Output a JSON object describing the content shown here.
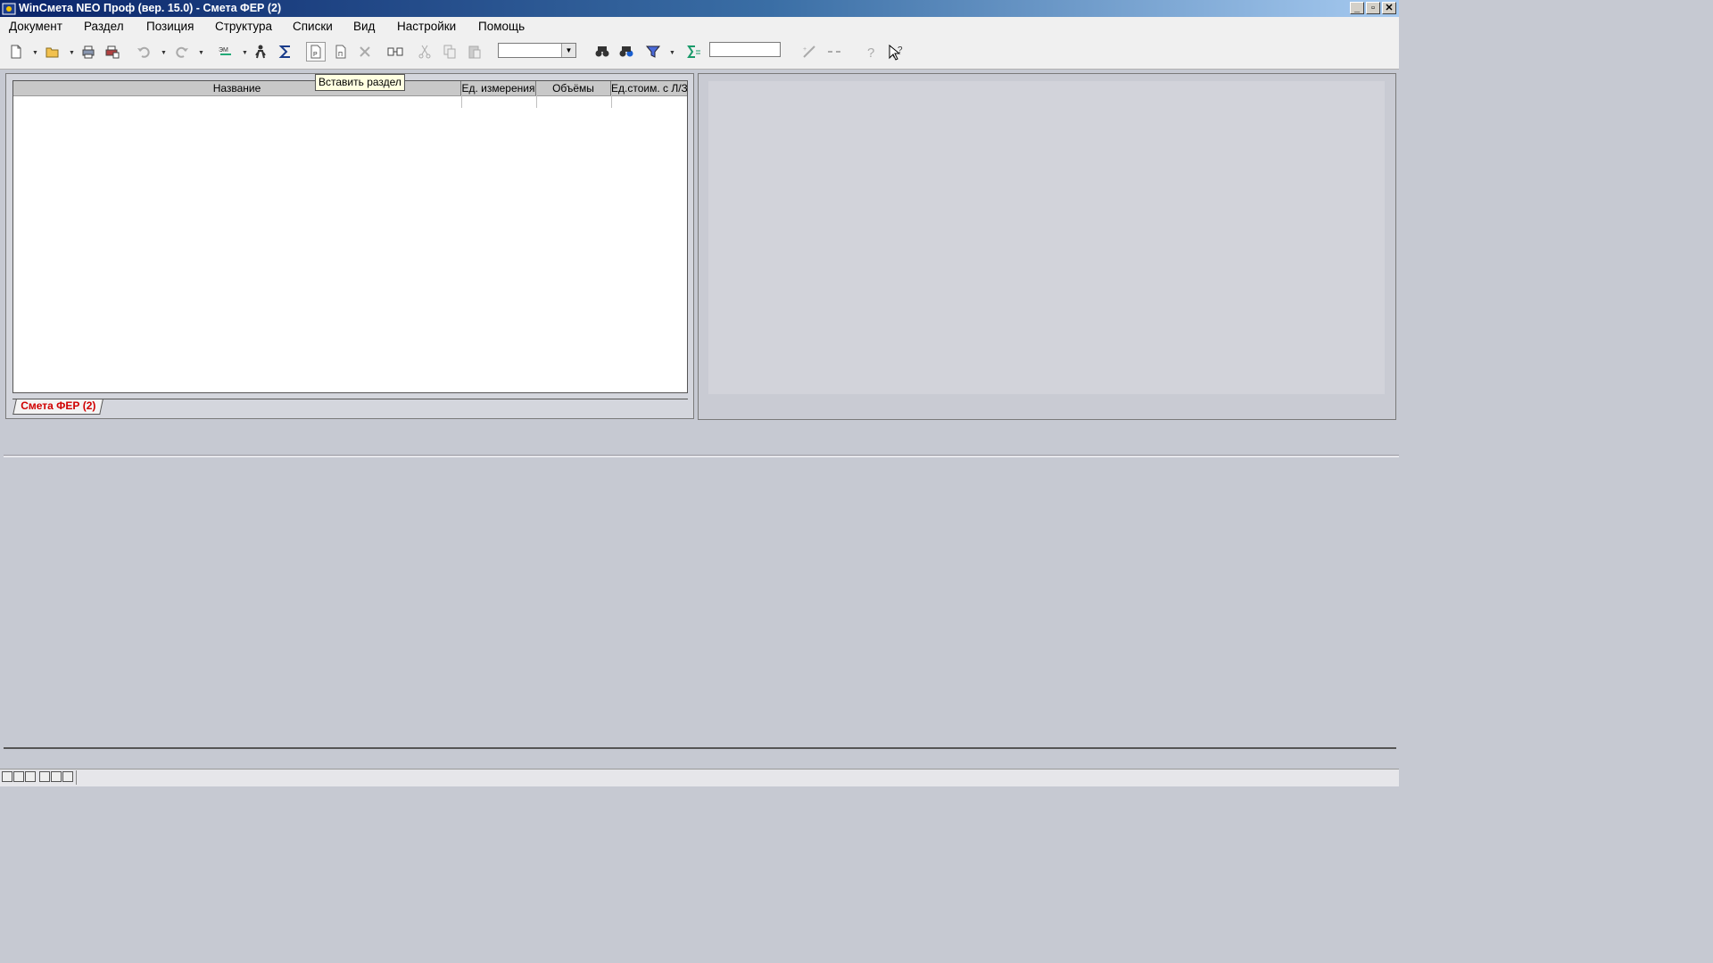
{
  "window": {
    "title": "WinСмета NEO Проф (вер. 15.0) - Смета ФЕР (2)"
  },
  "menu": {
    "items": [
      {
        "label": "Документ"
      },
      {
        "label": "Раздел"
      },
      {
        "label": "Позиция"
      },
      {
        "label": "Структура"
      },
      {
        "label": "Списки"
      },
      {
        "label": "Вид"
      },
      {
        "label": "Настройки"
      },
      {
        "label": "Помощь"
      }
    ]
  },
  "toolbar": {
    "icons": [
      "new-document-icon",
      "open-folder-icon",
      "print-icon",
      "print-preview-icon",
      "undo-icon",
      "redo-icon",
      "calculate-icon",
      "person-icon",
      "sum-icon",
      "insert-section-icon",
      "insert-position-icon",
      "delete-icon",
      "transfer-icon",
      "cut-icon",
      "copy-icon",
      "paste-icon",
      "find-icon",
      "find-next-icon",
      "filter-icon",
      "sum-field-icon",
      "percent-icon",
      "minus-icon",
      "help-icon",
      "context-help-icon"
    ],
    "combo_value": "",
    "search_value": "",
    "tooltip": "Вставить раздел"
  },
  "grid": {
    "columns": [
      "Название",
      "Ед. измерения",
      "Объёмы",
      "Ед.стоим. с Л/З"
    ],
    "rows": []
  },
  "tabs": [
    {
      "label": "Смета ФЕР (2)",
      "color": "#d00000"
    }
  ],
  "colors": {
    "titlebar_start": "#0a246a",
    "titlebar_end": "#a6caf0",
    "tooltip_bg": "#ffffe1"
  }
}
